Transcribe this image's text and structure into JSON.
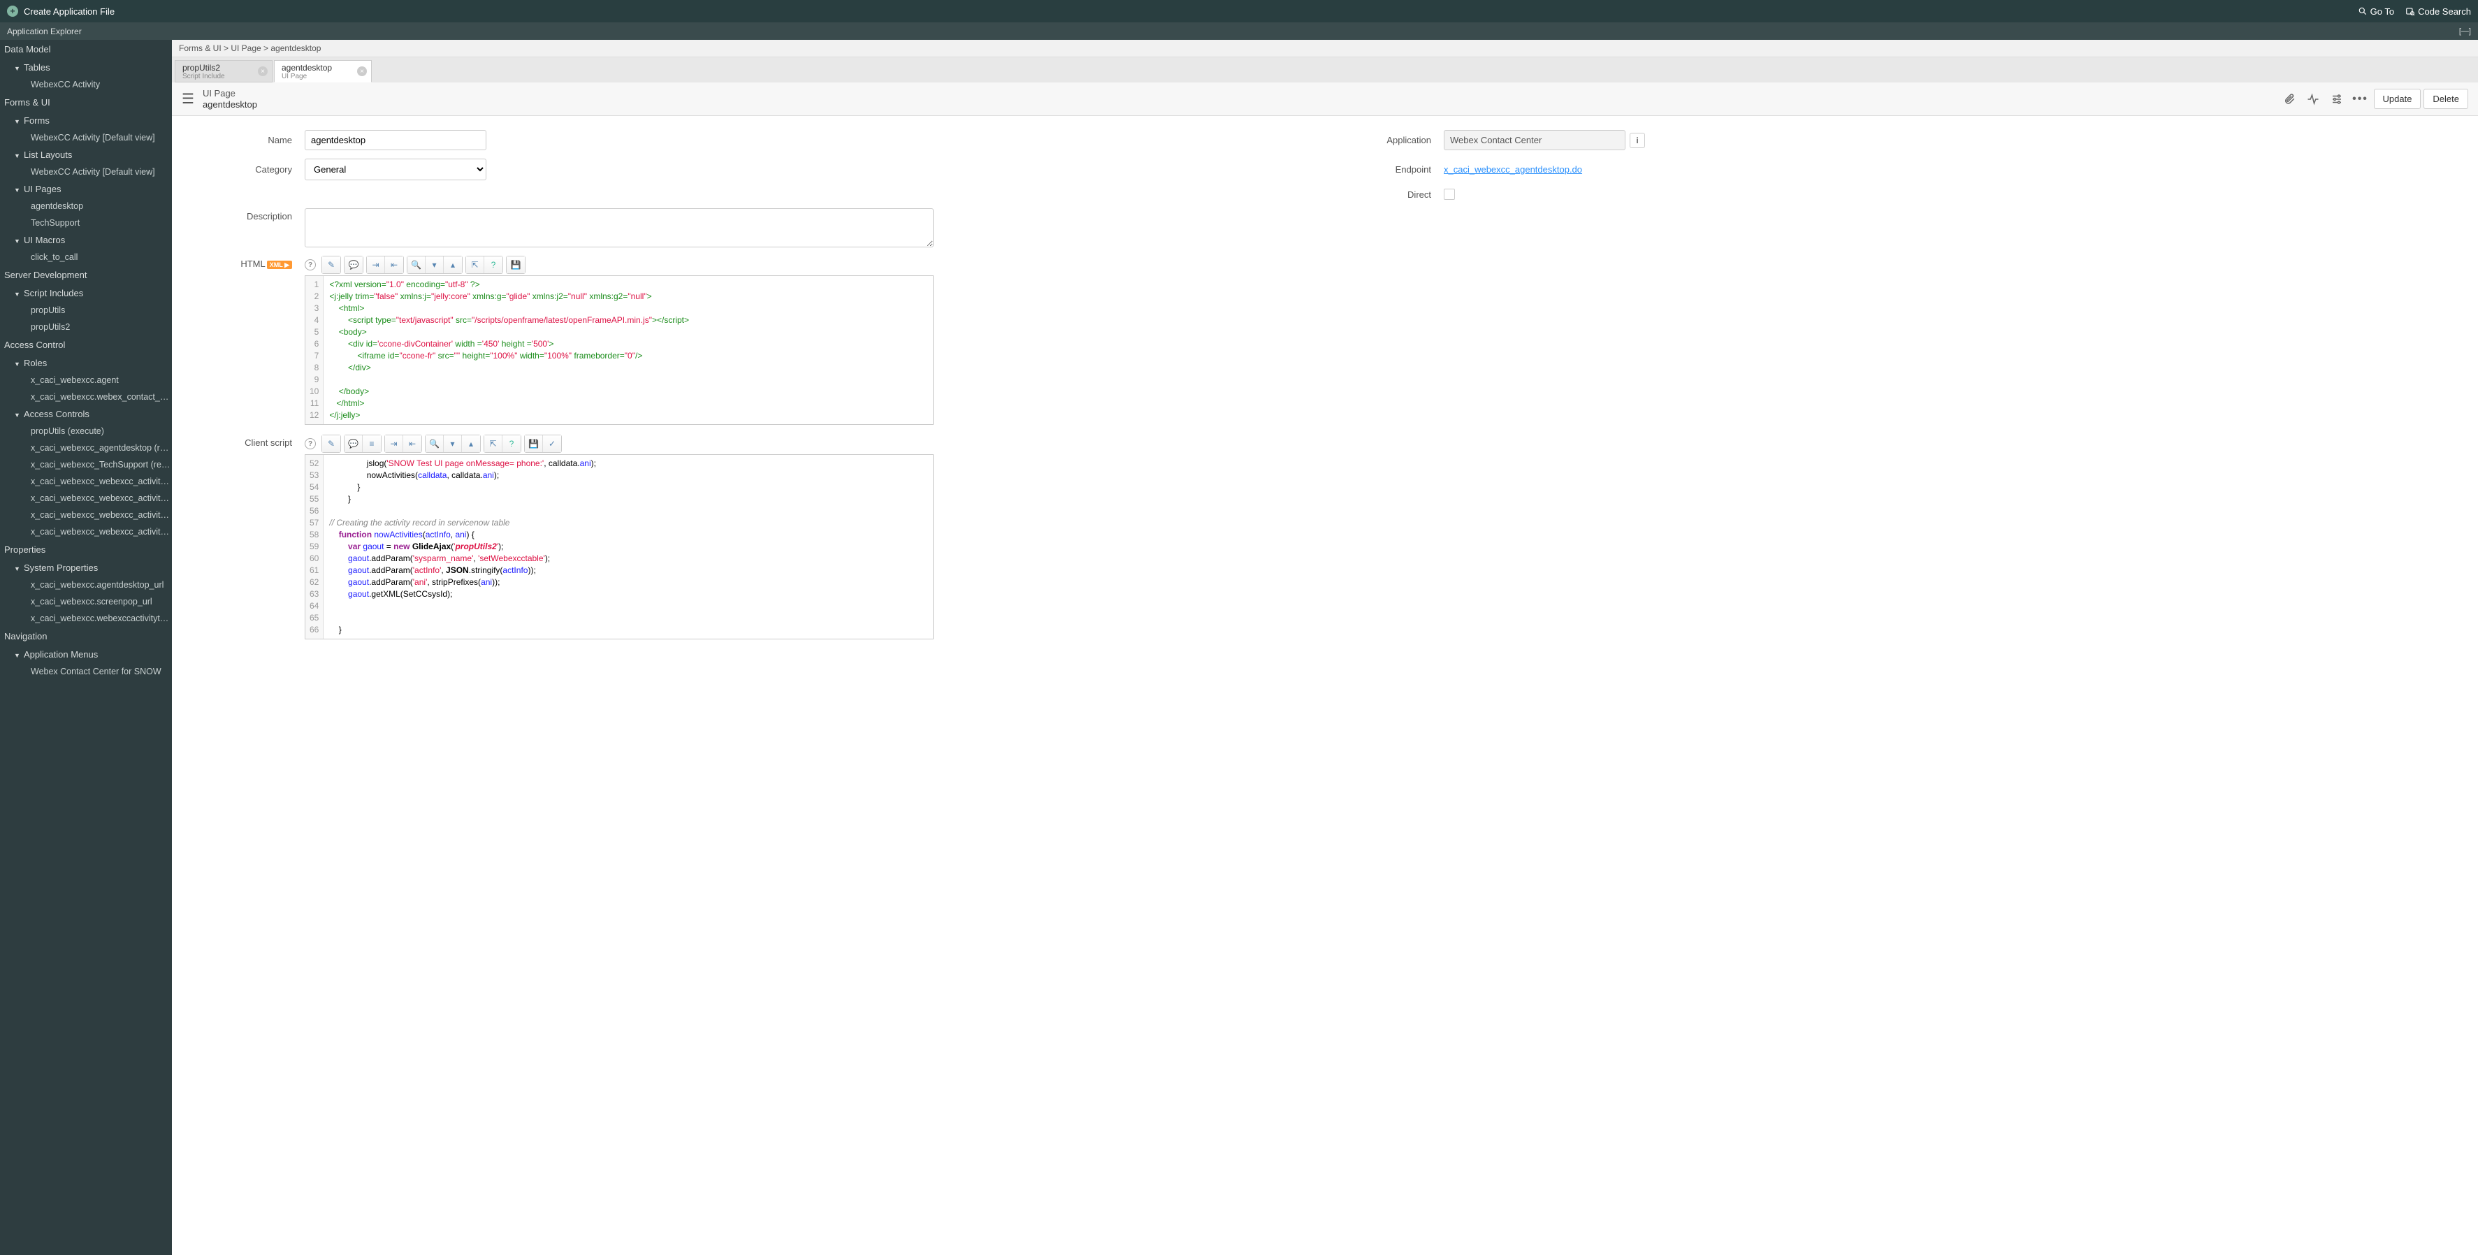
{
  "topbar": {
    "create_label": "Create Application File",
    "goto_label": "Go To",
    "code_search_label": "Code Search"
  },
  "subheader": {
    "title": "Application Explorer",
    "collapse": "[—]"
  },
  "sidebar": {
    "groups": [
      {
        "label": "Data Model",
        "children": [
          {
            "label": "Tables",
            "expandable": true,
            "children": [
              {
                "label": "WebexCC Activity"
              }
            ]
          }
        ]
      },
      {
        "label": "Forms & UI",
        "children": [
          {
            "label": "Forms",
            "expandable": true,
            "children": [
              {
                "label": "WebexCC Activity [Default view]"
              }
            ]
          },
          {
            "label": "List Layouts",
            "expandable": true,
            "children": [
              {
                "label": "WebexCC Activity [Default view]"
              }
            ]
          },
          {
            "label": "UI Pages",
            "expandable": true,
            "children": [
              {
                "label": "agentdesktop"
              },
              {
                "label": "TechSupport"
              }
            ]
          },
          {
            "label": "UI Macros",
            "expandable": true,
            "children": [
              {
                "label": "click_to_call"
              }
            ]
          }
        ]
      },
      {
        "label": "Server Development",
        "children": [
          {
            "label": "Script Includes",
            "expandable": true,
            "children": [
              {
                "label": "propUtils"
              },
              {
                "label": "propUtils2"
              }
            ]
          }
        ]
      },
      {
        "label": "Access Control",
        "children": [
          {
            "label": "Roles",
            "expandable": true,
            "children": [
              {
                "label": "x_caci_webexcc.agent"
              },
              {
                "label": "x_caci_webexcc.webex_contact_center"
              }
            ]
          },
          {
            "label": "Access Controls",
            "expandable": true,
            "children": [
              {
                "label": "propUtils (execute)"
              },
              {
                "label": "x_caci_webexcc_agentdesktop (read)"
              },
              {
                "label": "x_caci_webexcc_TechSupport (read)"
              },
              {
                "label": "x_caci_webexcc_webexcc_activity (delete)"
              },
              {
                "label": "x_caci_webexcc_webexcc_activity (create)"
              },
              {
                "label": "x_caci_webexcc_webexcc_activity (read)"
              },
              {
                "label": "x_caci_webexcc_webexcc_activity (write)"
              }
            ]
          }
        ]
      },
      {
        "label": "Properties",
        "children": [
          {
            "label": "System Properties",
            "expandable": true,
            "children": [
              {
                "label": "x_caci_webexcc.agentdesktop_url"
              },
              {
                "label": "x_caci_webexcc.screenpop_url"
              },
              {
                "label": "x_caci_webexcc.webexccactivitytable"
              }
            ]
          }
        ]
      },
      {
        "label": "Navigation",
        "children": [
          {
            "label": "Application Menus",
            "expandable": true,
            "children": [
              {
                "label": "Webex Contact Center for SNOW"
              }
            ]
          }
        ]
      }
    ]
  },
  "breadcrumb": "Forms & UI > UI Page > agentdesktop",
  "tabs": [
    {
      "title": "propUtils2",
      "sub": "Script Include",
      "active": false
    },
    {
      "title": "agentdesktop",
      "sub": "UI Page",
      "active": true
    }
  ],
  "form_header": {
    "type": "UI Page",
    "name": "agentdesktop",
    "update": "Update",
    "delete": "Delete"
  },
  "form": {
    "name_label": "Name",
    "name_value": "agentdesktop",
    "category_label": "Category",
    "category_value": "General",
    "application_label": "Application",
    "application_value": "Webex Contact Center",
    "endpoint_label": "Endpoint",
    "endpoint_value": "x_caci_webexcc_agentdesktop.do",
    "direct_label": "Direct",
    "description_label": "Description",
    "html_label": "HTML",
    "xml_badge": "XML ▶",
    "client_script_label": "Client script"
  },
  "html_editor": {
    "lines": [
      1,
      2,
      3,
      4,
      5,
      6,
      7,
      8,
      9,
      10,
      11,
      12
    ]
  },
  "client_editor": {
    "lines": [
      52,
      53,
      54,
      55,
      56,
      57,
      58,
      59,
      60,
      61,
      62,
      63,
      64,
      65,
      66
    ]
  }
}
